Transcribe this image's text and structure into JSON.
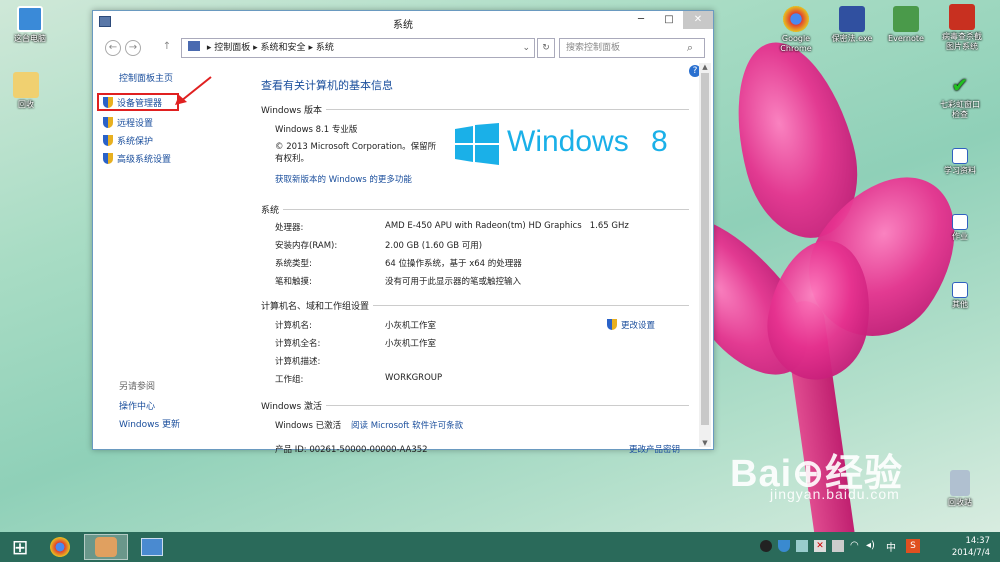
{
  "desktop": {
    "icons_left": [
      {
        "label": "这台电脑"
      },
      {
        "label": "回收"
      }
    ],
    "icons_right": [
      {
        "label": "Google\nChrome",
        "color": "#e04030"
      },
      {
        "label": "保密法.exe",
        "color": "#d8c020"
      },
      {
        "label": "Evernote",
        "color": "#4a9a4a"
      },
      {
        "label": "病毒查杀截\n图片系统",
        "color": "#c83020"
      },
      {
        "label": "七彩虹窗口\n检查",
        "color": "#20a020"
      },
      {
        "label": "学习资料",
        "color": "#3060c0"
      },
      {
        "label": "作业",
        "color": "#3060c0"
      },
      {
        "label": "其他",
        "color": "#3060c0"
      },
      {
        "label": "回收站",
        "color": "#8090a0"
      }
    ],
    "watermark": {
      "main": "Bai⊕经验",
      "url": "jingyan.baidu.com"
    }
  },
  "window": {
    "title": "系统",
    "controls": {
      "minimize": "─",
      "maximize": "□",
      "close": "✕"
    },
    "address": {
      "back": "←",
      "forward": "→",
      "up": "↑",
      "breadcrumb": [
        "控制面板",
        "系统和安全",
        "系统"
      ],
      "refresh": "↻",
      "search_placeholder": "搜索控制面板"
    },
    "left": {
      "home": "控制面板主页",
      "links": [
        "设备管理器",
        "远程设置",
        "系统保护",
        "高级系统设置"
      ],
      "see_also_title": "另请参阅",
      "see_also": [
        "操作中心",
        "Windows 更新"
      ]
    },
    "main": {
      "heading": "查看有关计算机的基本信息",
      "help": "?",
      "edition_section": "Windows 版本",
      "edition": "Windows 8.1 专业版",
      "copyright": "© 2013 Microsoft Corporation。保留所有权利。",
      "more_features_link": "获取新版本的 Windows 的更多功能",
      "logo_text": "Windows",
      "logo_num": "8",
      "system_section": "系统",
      "system_rows": [
        {
          "label": "处理器:",
          "value": "AMD E-450 APU with Radeon(tm) HD Graphics   1.65 GHz"
        },
        {
          "label": "安装内存(RAM):",
          "value": "2.00 GB (1.60 GB 可用)"
        },
        {
          "label": "系统类型:",
          "value": "64 位操作系统，基于 x64 的处理器"
        },
        {
          "label": "笔和触摸:",
          "value": "没有可用于此显示器的笔或触控输入"
        }
      ],
      "computer_section": "计算机名、域和工作组设置",
      "computer_rows": [
        {
          "label": "计算机名:",
          "value": "小灰机工作室"
        },
        {
          "label": "计算机全名:",
          "value": "小灰机工作室"
        },
        {
          "label": "计算机描述:",
          "value": ""
        },
        {
          "label": "工作组:",
          "value": "WORKGROUP"
        }
      ],
      "change_settings": "更改设置",
      "activation_section": "Windows 激活",
      "activated_text": "Windows 已激活",
      "license_link": "阅读 Microsoft 软件许可条款",
      "product_id": "产品 ID: 00261-50000-00000-AA352",
      "change_key": "更改产品密钥"
    }
  },
  "taskbar": {
    "start": "⊞",
    "tray": {
      "ime": "中",
      "s": "S"
    },
    "time": "14:37",
    "date": "2014/7/4"
  }
}
